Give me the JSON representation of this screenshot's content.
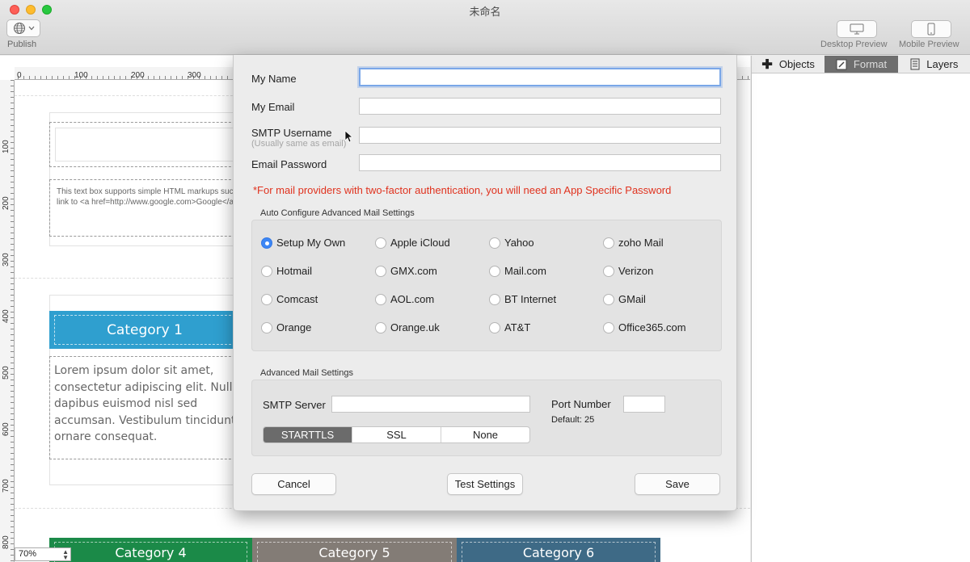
{
  "window": {
    "title": "未命名"
  },
  "toolbar": {
    "publish_label": "Publish",
    "desktop_preview_label": "Desktop Preview",
    "mobile_preview_label": "Mobile Preview"
  },
  "ruler": {
    "top_ticks": [
      "0",
      "100",
      "200",
      "300"
    ],
    "left_ticks": [
      "100",
      "200",
      "300",
      "400",
      "500",
      "600",
      "700",
      "800"
    ]
  },
  "canvas": {
    "textbox_line1": "This text box supports simple HTML markups such",
    "textbox_line2": "link to <a href=http://www.google.com>Google</a>",
    "category1": "Category 1",
    "lorem_lines": [
      "Lorem ipsum dolor sit amet,",
      "consectetur adipiscing elit. Nullam",
      "dapibus euismod nisl sed",
      "accumsan. Vestibulum tincidunt",
      "ornare consequat."
    ],
    "category4": "Category 4",
    "category5": "Category 5",
    "category6": "Category 6",
    "zoom": "70%"
  },
  "panel": {
    "tabs": [
      {
        "label": "Objects",
        "icon": "plus-icon"
      },
      {
        "label": "Format",
        "icon": "brush-icon",
        "active": true
      },
      {
        "label": "Layers",
        "icon": "layers-icon"
      }
    ]
  },
  "form": {
    "name_label": "My Name",
    "name_value": "",
    "email_label": "My Email",
    "email_value": "",
    "smtp_user_label": "SMTP Username",
    "smtp_user_hint": "(Usually same as email)",
    "smtp_user_value": "",
    "password_label": "Email Password",
    "password_value": "",
    "warning": "*For mail providers with two-factor authentication, you will need an App Specific Password",
    "auto_group_title": "Auto Configure Advanced Mail Settings",
    "providers": [
      [
        "Setup My Own",
        "Apple iCloud",
        "Yahoo",
        "zoho Mail"
      ],
      [
        "Hotmail",
        "GMX.com",
        "Mail.com",
        "Verizon"
      ],
      [
        "Comcast",
        "AOL.com",
        "BT Internet",
        "GMail"
      ],
      [
        "Orange",
        "Orange.uk",
        "AT&T",
        "Office365.com"
      ]
    ],
    "selected_provider": "Setup My Own",
    "advanced_group_title": "Advanced Mail Settings",
    "smtp_server_label": "SMTP Server",
    "smtp_server_value": "",
    "port_label": "Port Number",
    "port_value": "",
    "port_default": "Default: 25",
    "security_options": [
      "STARTTLS",
      "SSL",
      "None"
    ],
    "selected_security": "STARTTLS",
    "cancel_label": "Cancel",
    "test_label": "Test Settings",
    "save_label": "Save"
  },
  "colors": {
    "accent": "#3d87f5",
    "warning": "#e0321e",
    "category1": "#2f9fcf",
    "category4": "#1b8a48",
    "category5": "#837c76",
    "category6": "#3e6a86"
  }
}
